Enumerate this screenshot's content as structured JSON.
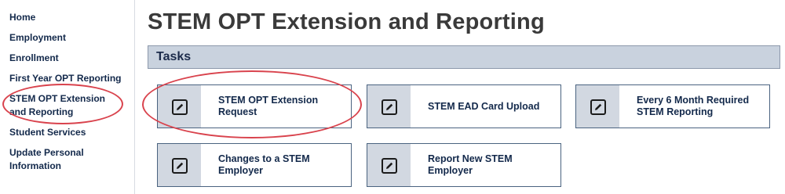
{
  "sidebar": {
    "items": [
      {
        "label": "Home"
      },
      {
        "label": "Employment"
      },
      {
        "label": "Enrollment"
      },
      {
        "label": "First Year OPT Reporting"
      },
      {
        "label": "STEM OPT Extension and Reporting"
      },
      {
        "label": "Student Services"
      },
      {
        "label": "Update Personal Information"
      }
    ]
  },
  "main": {
    "title": "STEM OPT Extension and Reporting",
    "section_title": "Tasks",
    "tasks": [
      {
        "label": "STEM OPT Extension Request",
        "icon": "edit-icon"
      },
      {
        "label": "STEM EAD Card Upload",
        "icon": "edit-icon"
      },
      {
        "label": "Every 6 Month Required STEM Reporting",
        "icon": "edit-icon"
      },
      {
        "label": "Changes to a STEM Employer",
        "icon": "edit-icon"
      },
      {
        "label": "Report New STEM Employer",
        "icon": "edit-icon"
      }
    ]
  },
  "colors": {
    "annotation_red": "#d9434d",
    "task_border": "#4a6380",
    "icon_panel": "#d2d8e1",
    "section_bar": "#c9d2de"
  }
}
